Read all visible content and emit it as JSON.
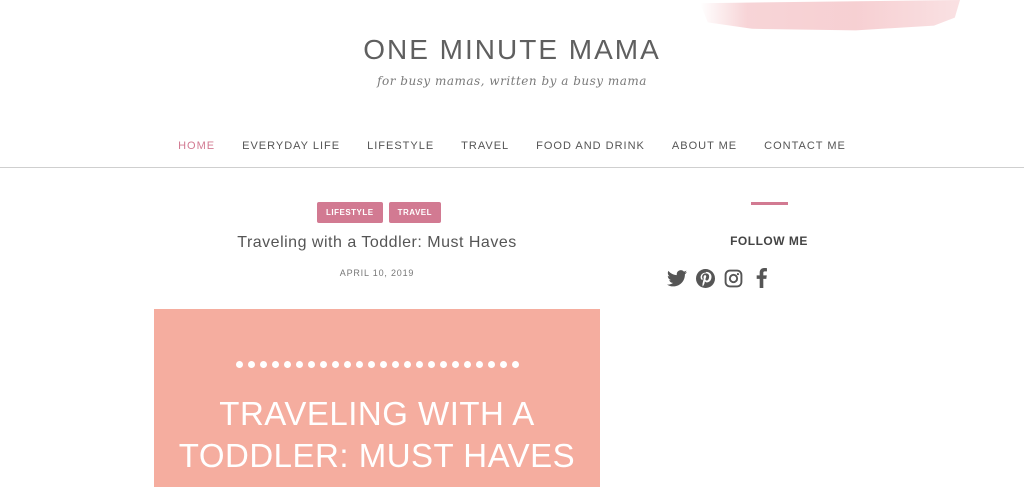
{
  "header": {
    "site_title": "ONE MINUTE MAMA",
    "tagline": "for busy mamas, written by a busy mama"
  },
  "nav": {
    "items": [
      {
        "label": "HOME",
        "active": true
      },
      {
        "label": "EVERYDAY LIFE",
        "active": false
      },
      {
        "label": "LIFESTYLE",
        "active": false
      },
      {
        "label": "TRAVEL",
        "active": false
      },
      {
        "label": "FOOD AND DRINK",
        "active": false
      },
      {
        "label": "ABOUT ME",
        "active": false
      },
      {
        "label": "CONTACT ME",
        "active": false
      }
    ]
  },
  "post": {
    "tags": [
      "LIFESTYLE",
      "TRAVEL"
    ],
    "title": "Traveling with a Toddler: Must Haves",
    "date": "APRIL 10, 2019",
    "image_text_line1": "TRAVELING WITH A",
    "image_text_line2": "TODDLER: MUST HAVES"
  },
  "sidebar": {
    "follow_label": "FOLLOW ME",
    "socials": [
      "twitter-icon",
      "pinterest-icon",
      "instagram-icon",
      "facebook-icon"
    ]
  },
  "colors": {
    "accent": "#d27a92",
    "image_bg": "#f5ad9f",
    "text": "#555555"
  }
}
